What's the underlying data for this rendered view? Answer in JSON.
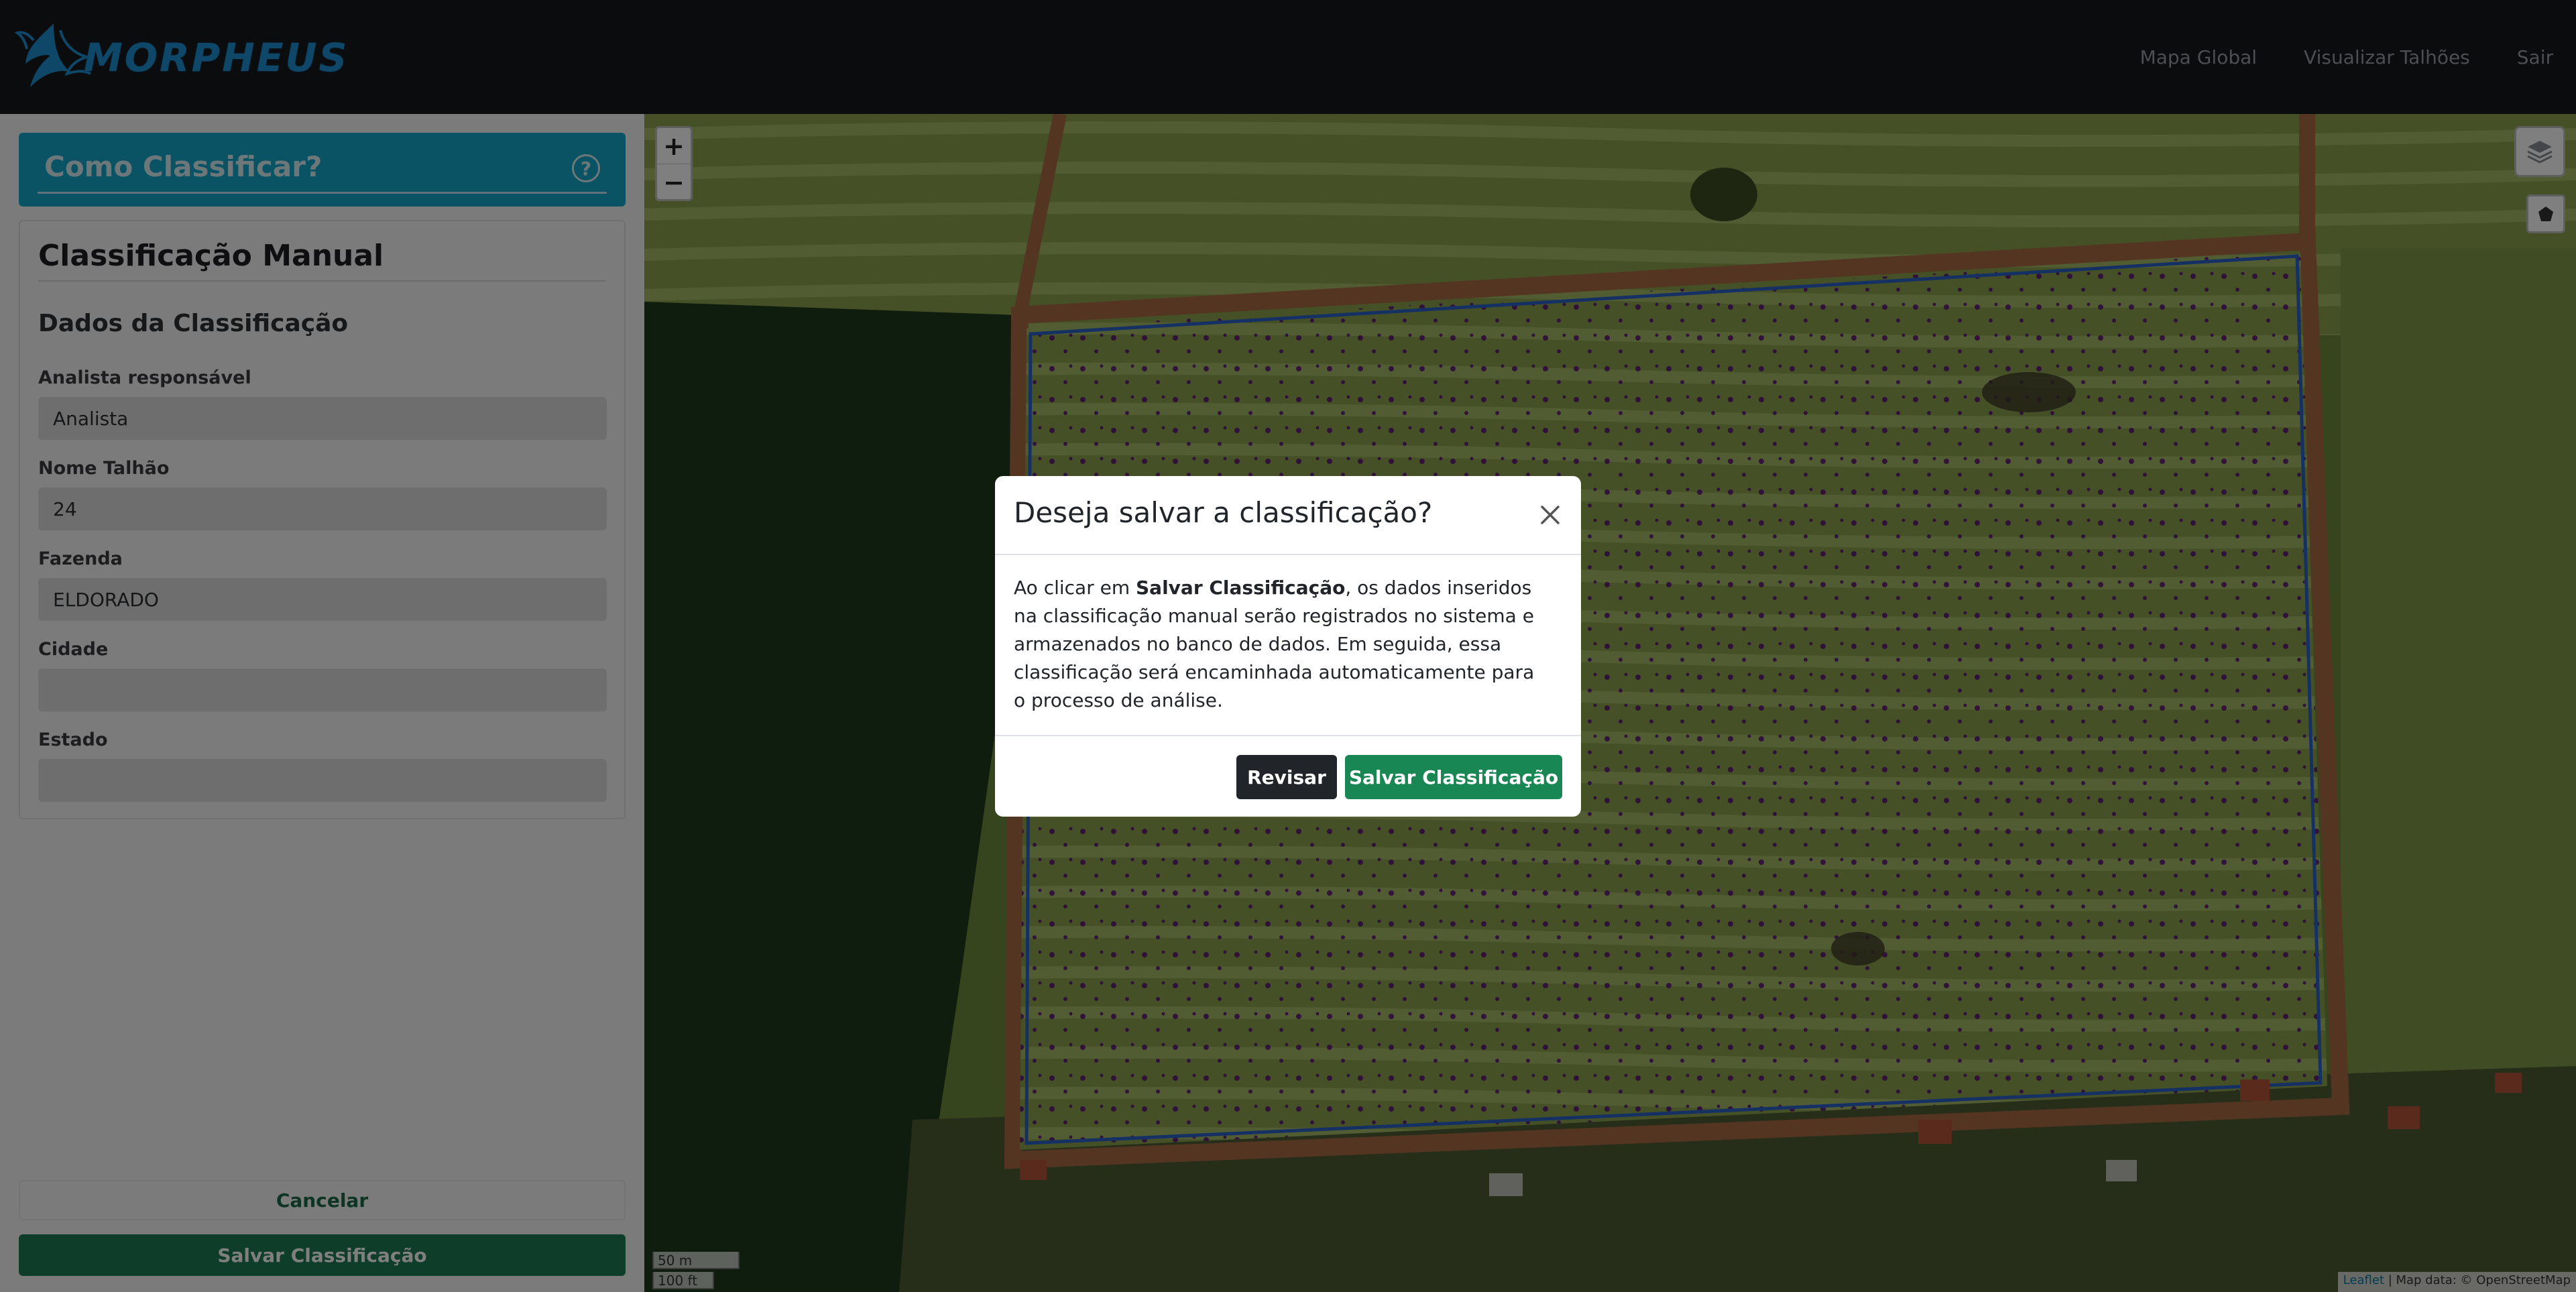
{
  "navbar": {
    "brand": "MORPHEUS",
    "logo_icon": "phoenix-icon",
    "links": [
      "Mapa Global",
      "Visualizar Talhões",
      "Sair"
    ]
  },
  "sidebar": {
    "help_title": "Como Classificar?",
    "help_icon": "question-circle-icon",
    "form_title": "Classificação Manual",
    "form_subtitle": "Dados da Classificação",
    "fields": [
      {
        "label": "Analista responsável",
        "value": "Analista"
      },
      {
        "label": "Nome Talhão",
        "value": "24"
      },
      {
        "label": "Fazenda",
        "value": "ELDORADO"
      },
      {
        "label": "Cidade",
        "value": ""
      },
      {
        "label": "Estado",
        "value": ""
      }
    ],
    "cancel_label": "Cancelar",
    "save_label": "Salvar Classificação"
  },
  "map": {
    "zoom_in": "+",
    "zoom_out": "−",
    "layers_icon": "layers-icon",
    "draw_icon": "polygon-draw-icon",
    "scale_metric": "50 m",
    "scale_imperial": "100 ft",
    "attribution_leaflet": "Leaflet",
    "attribution_rest": " | Map data: © OpenStreetMap"
  },
  "modal": {
    "title": "Deseja salvar a classificação?",
    "body_prefix": "Ao clicar em ",
    "body_bold": "Salvar Classificação",
    "body_suffix": ", os dados inseridos na classificação manual serão registrados no sistema e armazenados no banco de dados. Em seguida, essa classificação será encaminhada automaticamente para o processo de análise.",
    "review_label": "Revisar",
    "save_label": "Salvar Classificação"
  },
  "colors": {
    "navbar_bg": "#17191d",
    "brand_blue": "#1c8fd0",
    "help_card": "#14a6c8",
    "save_green": "#1d7a52",
    "modal_green": "#198754",
    "review_dark": "#212529",
    "field_outline": "#2b63c9",
    "classified_purple": "#5a0f7a"
  }
}
